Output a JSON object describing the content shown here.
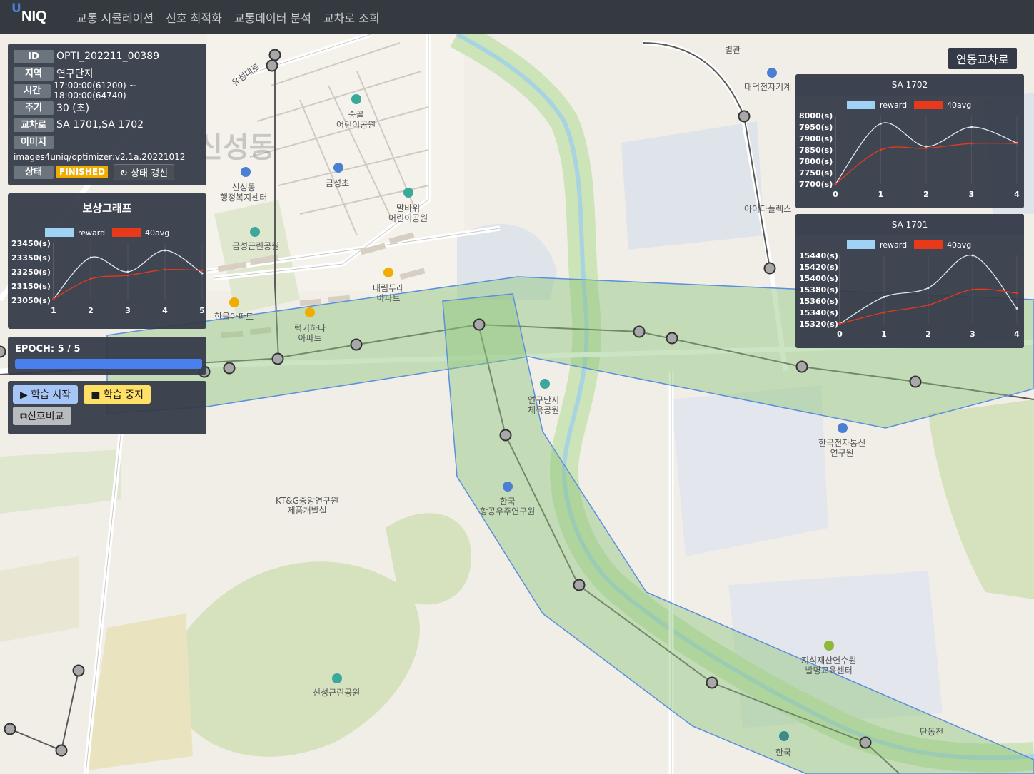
{
  "app": {
    "logo_u": "U",
    "logo_text": "NIQ",
    "nav": [
      "교통 시뮬레이션",
      "신호 최적화",
      "교통데이터 분석",
      "교차로 조회"
    ]
  },
  "info": {
    "id_label": "ID",
    "id_value": "OPTI_202211_00389",
    "region_label": "지역",
    "region_value": "연구단지",
    "time_label": "시간",
    "time_value": "17:00:00(61200) ~ 18:00:00(64740)",
    "period_label": "주기",
    "period_value": "30 (초)",
    "intersection_label": "교차로",
    "intersection_value": "SA 1701,SA 1702",
    "image_label": "이미지",
    "image_value": "images4uniq/optimizer:v2.1a.20221012",
    "status_label": "상태",
    "status_value": "FINISHED",
    "refresh_label": "상태 갱신"
  },
  "reward_chart_title": "보상그래프",
  "epoch": {
    "label": "EPOCH: 5 / 5",
    "progress": 1.0
  },
  "controls": {
    "start": "학습 시작",
    "stop": "학습 중지",
    "compare": "신호비교"
  },
  "linked_button": "연동교차로",
  "colors": {
    "reward": "#9fd2f5",
    "avg": "#e8391a",
    "progress": "#4a7ff0",
    "status": "#f0ad00",
    "zone": "#8cc47a"
  },
  "map_labels": {
    "sinseong": "신성동",
    "sinseong_office": "신성동\n행정복지센터",
    "sukgol": "숲골\n어린이공원",
    "geumseong_school": "금성초",
    "malbawi": "말바위\n어린이공원",
    "geumseong_park": "금성근린공원",
    "hanul": "한울아파트",
    "lucky": "럭키하나\n아파트",
    "daerim": "대림두레\n아파트",
    "byeolgwan": "별관",
    "daedeok": "대덕전자기계",
    "itower": "아이타플렉스",
    "sports_park": "연구단지\n체육공원",
    "etri": "한국전자통신\n연구원",
    "ktng": "KT&G중앙연구원\n제품개발실",
    "kari": "한국\n항공우주연구원",
    "sinseong_park": "신성근린공원",
    "ip_center": "지식재산연수원\n발명교육센터",
    "tandong": "탄동천",
    "bottom_korea": "한국",
    "yuseong_road": "유성대로"
  },
  "chart_data": [
    {
      "id": "reward",
      "type": "line",
      "title": "보상그래프",
      "x": [
        1,
        2,
        3,
        4,
        5
      ],
      "yticks": [
        "23450(s)",
        "23350(s)",
        "23250(s)",
        "23150(s)",
        "23050(s)"
      ],
      "ylim": [
        23050,
        23450
      ],
      "series": [
        {
          "name": "reward",
          "values": [
            23060,
            23350,
            23250,
            23400,
            23240
          ]
        },
        {
          "name": "40avg",
          "values": [
            23060,
            23200,
            23225,
            23265,
            23260
          ]
        }
      ],
      "legend": "top"
    },
    {
      "id": "sa1702",
      "type": "line",
      "title": "SA 1702",
      "x": [
        0,
        1,
        2,
        3,
        4
      ],
      "yticks": [
        "8000(s)",
        "7950(s)",
        "7900(s)",
        "7850(s)",
        "7800(s)",
        "7750(s)",
        "7700(s)"
      ],
      "ylim": [
        7700,
        8000
      ],
      "series": [
        {
          "name": "reward",
          "values": [
            7700,
            7965,
            7865,
            7950,
            7880
          ]
        },
        {
          "name": "40avg",
          "values": [
            7700,
            7850,
            7857,
            7878,
            7878
          ]
        }
      ],
      "legend": "top"
    },
    {
      "id": "sa1701",
      "type": "line",
      "title": "SA 1701",
      "x": [
        0,
        1,
        2,
        3,
        4
      ],
      "yticks": [
        "15440(s)",
        "15420(s)",
        "15400(s)",
        "15380(s)",
        "15360(s)",
        "15340(s)",
        "15320(s)"
      ],
      "ylim": [
        15320,
        15440
      ],
      "series": [
        {
          "name": "reward",
          "values": [
            15320,
            15367,
            15383,
            15440,
            15347
          ]
        },
        {
          "name": "40avg",
          "values": [
            15320,
            15340,
            15353,
            15380,
            15374
          ]
        }
      ],
      "legend": "top"
    }
  ]
}
